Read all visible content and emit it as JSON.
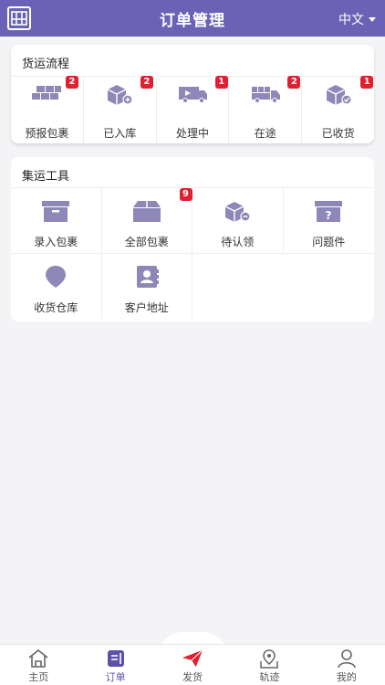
{
  "header": {
    "title": "订单管理",
    "language": "中文",
    "logo_icon": "app-logo-icon"
  },
  "flow": {
    "title": "货运流程",
    "items": [
      {
        "label": "预报包裹",
        "badge": "2",
        "icon": "boxes-forecast-icon"
      },
      {
        "label": "已入库",
        "badge": "2",
        "icon": "box-add-icon"
      },
      {
        "label": "处理中",
        "badge": "1",
        "icon": "truck-processing-icon"
      },
      {
        "label": "在途",
        "badge": "2",
        "icon": "truck-transit-icon"
      },
      {
        "label": "已收货",
        "badge": "1",
        "icon": "box-check-icon"
      }
    ]
  },
  "tools": {
    "title": "集运工具",
    "items": [
      {
        "label": "录入包裹",
        "badge": "",
        "icon": "archive-box-icon"
      },
      {
        "label": "全部包裹",
        "badge": "9",
        "icon": "package-icon"
      },
      {
        "label": "待认领",
        "badge": "",
        "icon": "box-pending-icon"
      },
      {
        "label": "问题件",
        "badge": "",
        "icon": "box-question-icon"
      },
      {
        "label": "收货仓库",
        "badge": "",
        "icon": "location-pin-icon"
      },
      {
        "label": "客户地址",
        "badge": "",
        "icon": "address-book-icon"
      }
    ]
  },
  "tabbar": {
    "items": [
      {
        "label": "主页",
        "icon": "home-icon"
      },
      {
        "label": "订单",
        "icon": "orders-icon"
      },
      {
        "label": "发货",
        "icon": "paper-plane-icon"
      },
      {
        "label": "轨迹",
        "icon": "map-track-icon"
      },
      {
        "label": "我的",
        "icon": "user-icon"
      }
    ],
    "active": "订单"
  },
  "colors": {
    "brand": "#6b62b5",
    "icon": "#8e88b8",
    "badge": "#e02030",
    "send_accent": "#e02030"
  }
}
